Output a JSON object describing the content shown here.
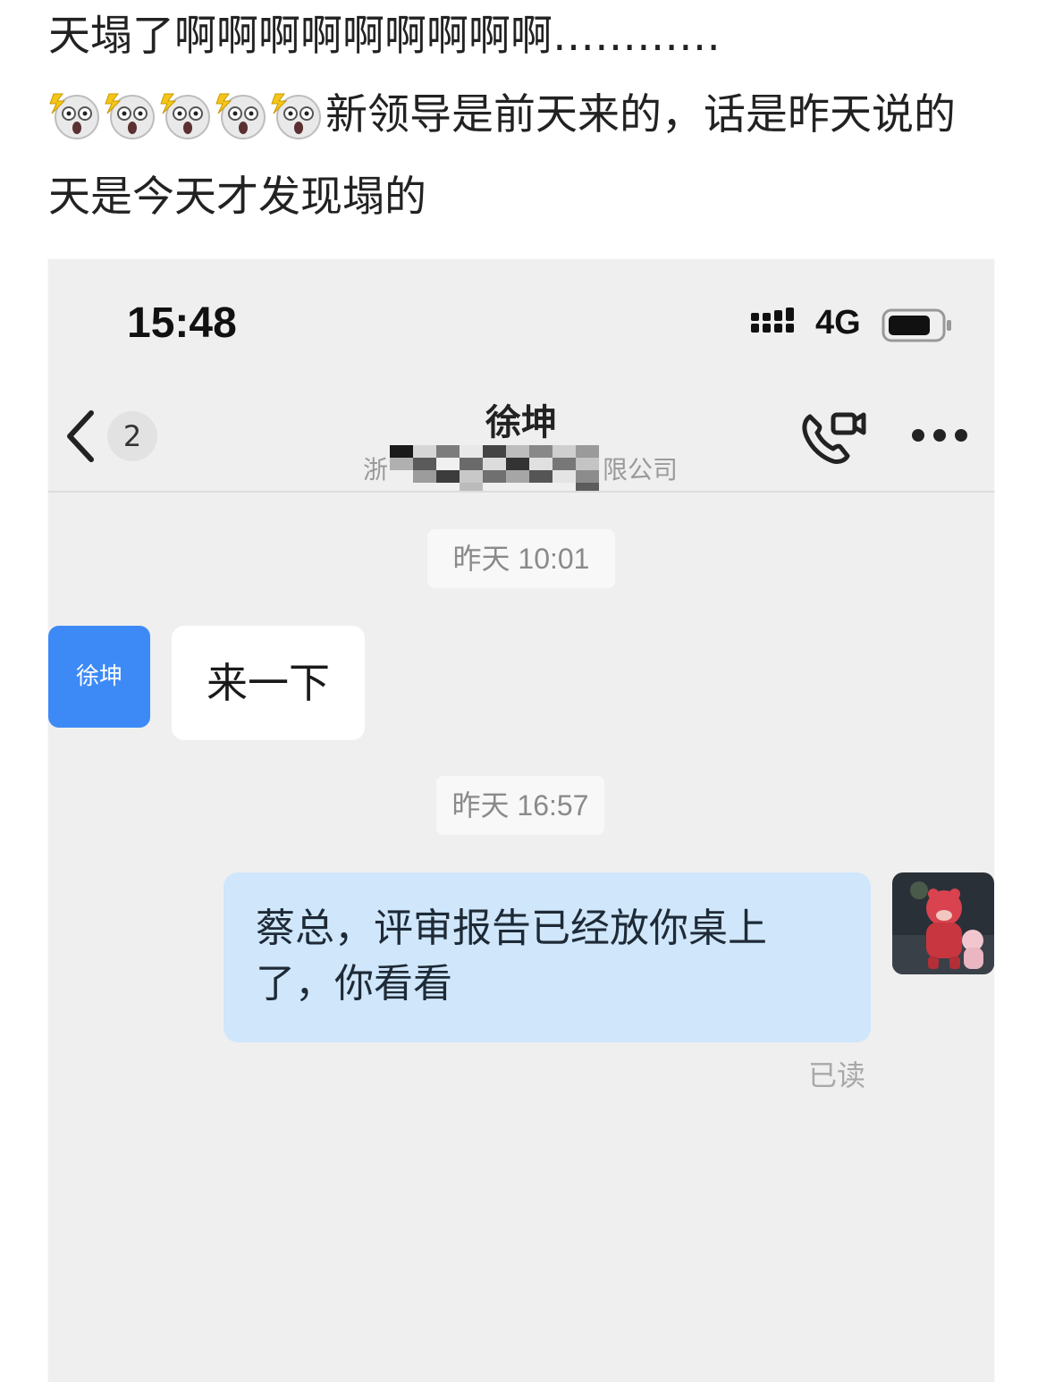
{
  "post": {
    "line1": "天塌了啊啊啊啊啊啊啊啊啊…………",
    "line2_emojis": [
      "shocked-face-emoji",
      "shocked-face-emoji",
      "shocked-face-emoji",
      "shocked-face-emoji",
      "shocked-face-emoji"
    ],
    "line2_text": "新领导是前天来的，话是昨天说的",
    "line3": "天是今天才发现塌的"
  },
  "status_bar": {
    "time": "15:48",
    "network": "4G"
  },
  "header": {
    "unread_count": "2",
    "contact_name": "徐坤",
    "company_prefix": "浙",
    "company_suffix": "限公司"
  },
  "messages": {
    "timestamp_1": "昨天 10:01",
    "incoming_avatar_text": "徐坤",
    "incoming_text": "来一下",
    "timestamp_2": "昨天 16:57",
    "outgoing_text": "蔡总，评审报告已经放你桌上了，你看看",
    "read_status": "已读"
  },
  "colors": {
    "avatar_blue": "#3d8af7",
    "outgoing_bubble": "#cfe6fb",
    "chat_background": "#efefef"
  }
}
